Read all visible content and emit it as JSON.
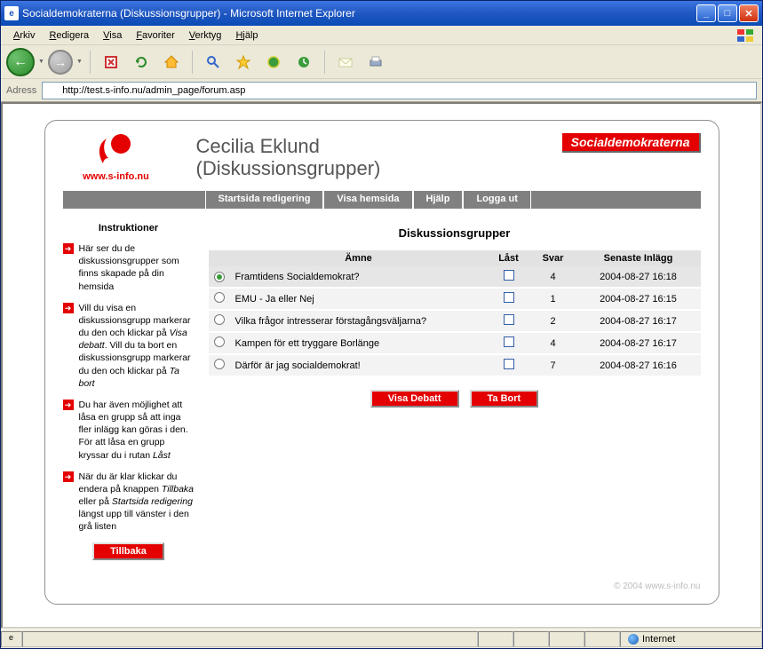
{
  "window": {
    "title": "Socialdemokraterna (Diskussionsgrupper) - Microsoft Internet Explorer"
  },
  "menubar": [
    "Arkiv",
    "Redigera",
    "Visa",
    "Favoriter",
    "Verktyg",
    "Hjälp"
  ],
  "address": {
    "label": "Adress",
    "url": "http://test.s-info.nu/admin_page/forum.asp"
  },
  "brand": "Socialdemokraterna",
  "site_url": "www.s-info.nu",
  "page_heading": {
    "line1": "Cecilia Eklund",
    "line2": "(Diskussionsgrupper)"
  },
  "nav": [
    "Startsida redigering",
    "Visa hemsida",
    "Hjälp",
    "Logga ut"
  ],
  "sidebar": {
    "heading": "Instruktioner",
    "items_html": [
      "Här ser du de diskussionsgrupper som finns skapade på din hemsida",
      "Vill du visa en diskussionsgrupp markerar du den och klickar på <em>Visa debatt</em>. Vill du ta bort en diskussionsgrupp markerar du den och klickar på <em>Ta bort</em>",
      "Du har även möjlighet att låsa en grupp så att inga fler inlägg kan göras i den. För att låsa en grupp kryssar du i rutan <em>Låst</em>",
      "När du är klar klickar du endera på knappen <em>Tillbaka</em> eller på <em>Startsida redigering</em> längst upp till vänster i den grå listen"
    ],
    "back_button": "Tillbaka"
  },
  "main": {
    "heading": "Diskussionsgrupper",
    "columns": {
      "topic": "Ämne",
      "locked": "Låst",
      "replies": "Svar",
      "latest": "Senaste Inlägg"
    },
    "rows": [
      {
        "selected": true,
        "topic": "Framtidens Socialdemokrat?",
        "locked": false,
        "replies": 4,
        "latest": "2004-08-27 16:18"
      },
      {
        "selected": false,
        "topic": "EMU - Ja eller Nej",
        "locked": false,
        "replies": 1,
        "latest": "2004-08-27 16:15"
      },
      {
        "selected": false,
        "topic": "Vilka frågor intresserar förstagångsväljarna?",
        "locked": false,
        "replies": 2,
        "latest": "2004-08-27 16:17"
      },
      {
        "selected": false,
        "topic": "Kampen för ett tryggare Borlänge",
        "locked": false,
        "replies": 4,
        "latest": "2004-08-27 16:17"
      },
      {
        "selected": false,
        "topic": "Därför är jag socialdemokrat!",
        "locked": false,
        "replies": 7,
        "latest": "2004-08-27 16:16"
      }
    ],
    "buttons": {
      "view": "Visa Debatt",
      "delete": "Ta Bort"
    }
  },
  "footer": "© 2004 www.s-info.nu",
  "statusbar": {
    "zone": "Internet"
  }
}
